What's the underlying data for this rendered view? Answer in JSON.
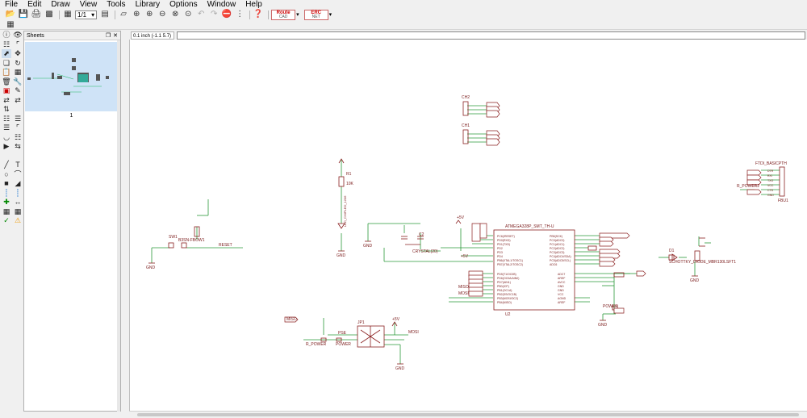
{
  "menu": [
    "File",
    "Edit",
    "Draw",
    "View",
    "Tools",
    "Library",
    "Options",
    "Window",
    "Help"
  ],
  "toolbar": {
    "sheet_selector": "1/1",
    "route_button_top": "Route",
    "route_button_bottom": "CAD",
    "erc_button_top": "ERC",
    "erc_button_bottom": "NET"
  },
  "sheets_panel": {
    "title": "Sheets",
    "sheet_number": "1"
  },
  "coordinate": "0.1 inch (-1.1 5.7)",
  "command_line": "",
  "icons": {
    "menu_toolbar": [
      "open-icon",
      "save-icon",
      "print-icon",
      "cam-icon",
      "board-icon",
      "sheet-combo",
      "script-icon",
      "ulp-icon",
      "zoom-fit-icon",
      "zoom-in-icon",
      "zoom-out-icon",
      "zoom-window-icon",
      "zoom-select-icon",
      "undo-icon",
      "redo-icon",
      "stop-icon",
      "go-icon",
      "help-icon"
    ]
  },
  "schematic": {
    "labels": {
      "ch2": "CH2",
      "ch1": "CH1",
      "ftdi": "FTDI_BASICPTH",
      "ftdi_pin_names": [
        "DTR",
        "RXI",
        "TXO",
        "VCC",
        "CTS",
        "GND"
      ],
      "ftdi_part": "FBU1",
      "mcu_name": "ATMEGA328P_SMT_TH-U",
      "mcu_ref": "U2",
      "mcu_left_pins": [
        "PC6(/RESET)",
        "PD0(RXD)",
        "PD1(TXD)",
        "PD2",
        "PD3",
        "PD4",
        "PB6(XTAL1/TOSC1)",
        "PB7(XTAL2/TOSC2)"
      ],
      "mcu_left_pins2": [
        "PD5(T1/OC0B)",
        "PD6(OC0A/AIN0)",
        "PD7(AIN1)",
        "PB0(ICP)",
        "PB1(OC1A)",
        "PB2(SS/OC1B)",
        "PB3(MOSI/OC2)",
        "PB4(MISO)"
      ],
      "mcu_right_pins": [
        "PB5(SCK)",
        "PC0(ADC0)",
        "PC1(ADC1)",
        "PC2(ADC2)",
        "PC3(ADC3)",
        "PC4(ADC4/SDA)",
        "PC5(ADC5/SCL)",
        "ADC6"
      ],
      "mcu_right_pins2": [
        "ADC7",
        "AREF",
        "AVCC",
        "GND",
        "GND",
        "VCC",
        "AGND",
        "AREF"
      ],
      "switch_ref": "SW1",
      "switch_part": "B3SN-FBOW1",
      "reset": "RESET",
      "gnd": "GND",
      "vcc_5v": "+5V",
      "led_part": "LED_CHIPLED_1206",
      "resistor": "R1",
      "resistor_value": "10K",
      "crystal": "CRYSTAL(20)",
      "cap": "C2",
      "diode": "D1",
      "diode_part": "SCHOTTKY_DIODE_MBR130LSFT1",
      "jp1": "JP1",
      "mosi": "MOSI",
      "miso": "MISO",
      "r_power": "R_POWER",
      "power": "POWER",
      "rpower2": "R_POWER2",
      "pse": "PSE"
    }
  }
}
